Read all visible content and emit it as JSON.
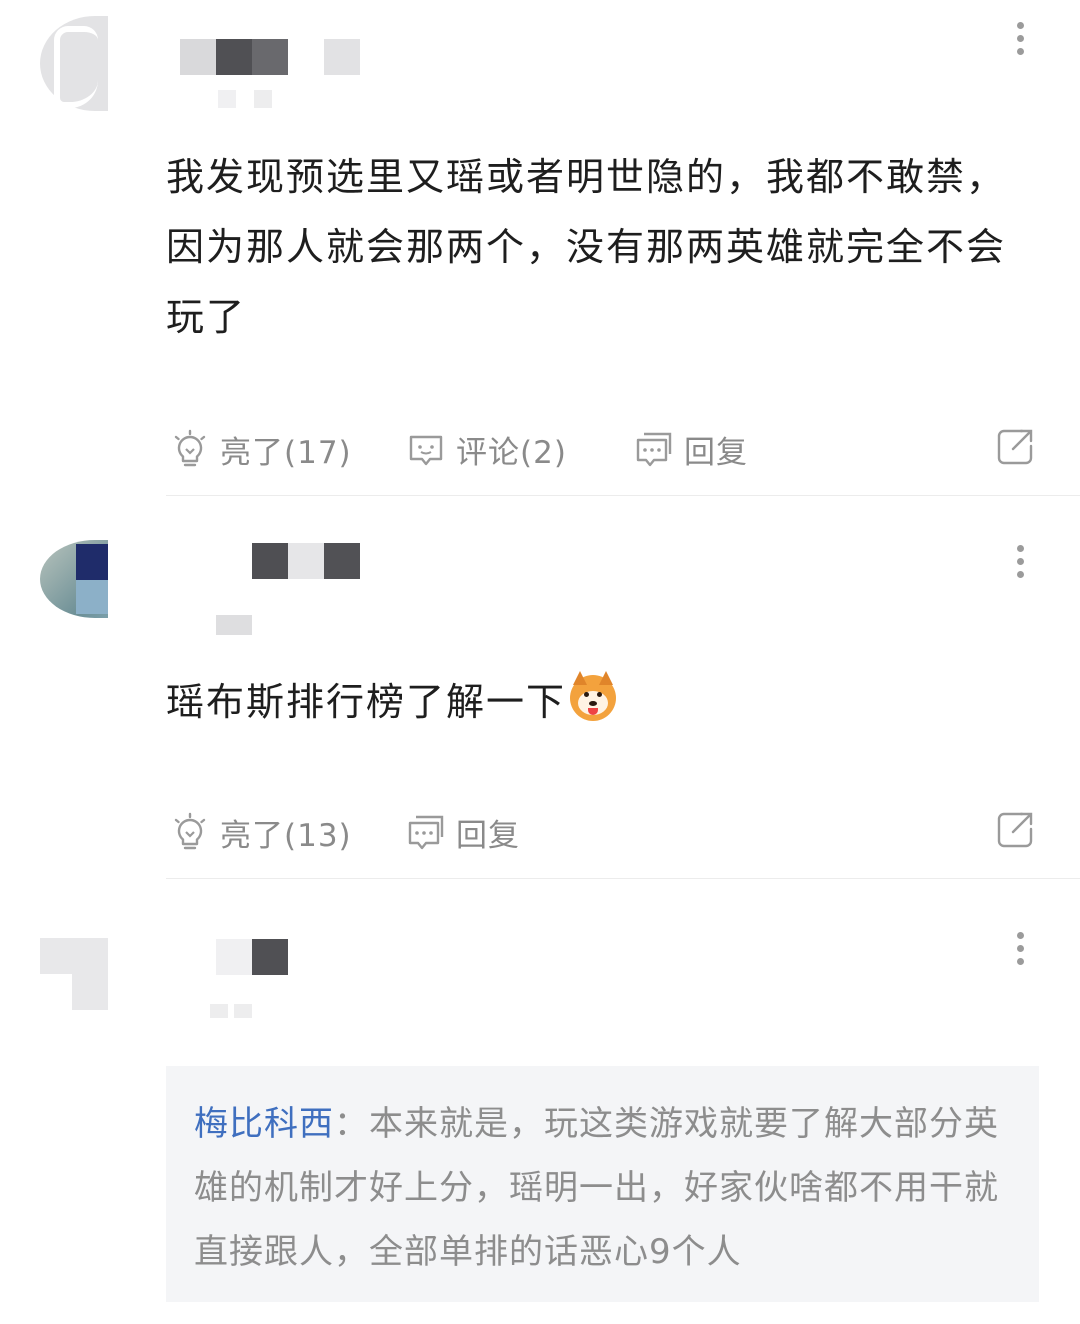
{
  "comments": [
    {
      "text": "我发现预选里又瑶或者明世隐的，我都不敢禁，因为那人就会那两个，没有那两英雄就完全不会玩了",
      "like_label": "亮了(17)",
      "comment_label": "评论(2)",
      "reply_label": "回复"
    },
    {
      "text": "瑶布斯排行榜了解一下",
      "emoji": "shiba-dog-emoji",
      "like_label": "亮了(13)",
      "reply_label": "回复"
    },
    {
      "quote": {
        "author": "梅比科西",
        "separator": "：",
        "text": "本来就是，玩这类游戏就要了解大部分英雄的机制才好上分，瑶明一出，好家伙啥都不用干就直接跟人，全部单排的话恶心9个人"
      }
    }
  ],
  "colors": {
    "link": "#3f6fbf",
    "muted": "#8a8a8a",
    "quote_bg": "#f4f5f7"
  },
  "icons": [
    "lightbulb-icon",
    "comment-bubble-icon",
    "reply-bubble-icon",
    "share-icon",
    "more-icon"
  ]
}
